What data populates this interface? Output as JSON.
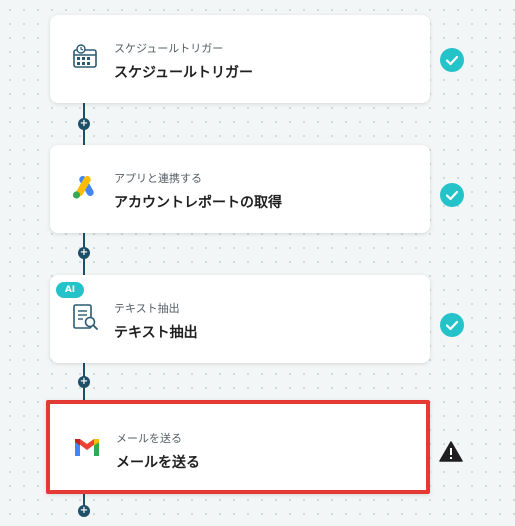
{
  "flow": {
    "steps": [
      {
        "label": "スケジュールトリガー",
        "title": "スケジュールトリガー",
        "icon": "calendar-clock-icon",
        "status": "complete"
      },
      {
        "label": "アプリと連携する",
        "title": "アカウントレポートの取得",
        "icon": "google-ads-icon",
        "status": "complete"
      },
      {
        "label": "テキスト抽出",
        "title": "テキスト抽出",
        "icon": "document-search-icon",
        "status": "complete",
        "badge": "AI"
      },
      {
        "label": "メールを送る",
        "title": "メールを送る",
        "icon": "gmail-icon",
        "status": "warning",
        "selected": true
      }
    ],
    "add_button": "+"
  },
  "colors": {
    "connector": "#1d4f66",
    "check": "#24c2c9",
    "selected_border": "#e53935",
    "warning": "#1f1f1f"
  }
}
